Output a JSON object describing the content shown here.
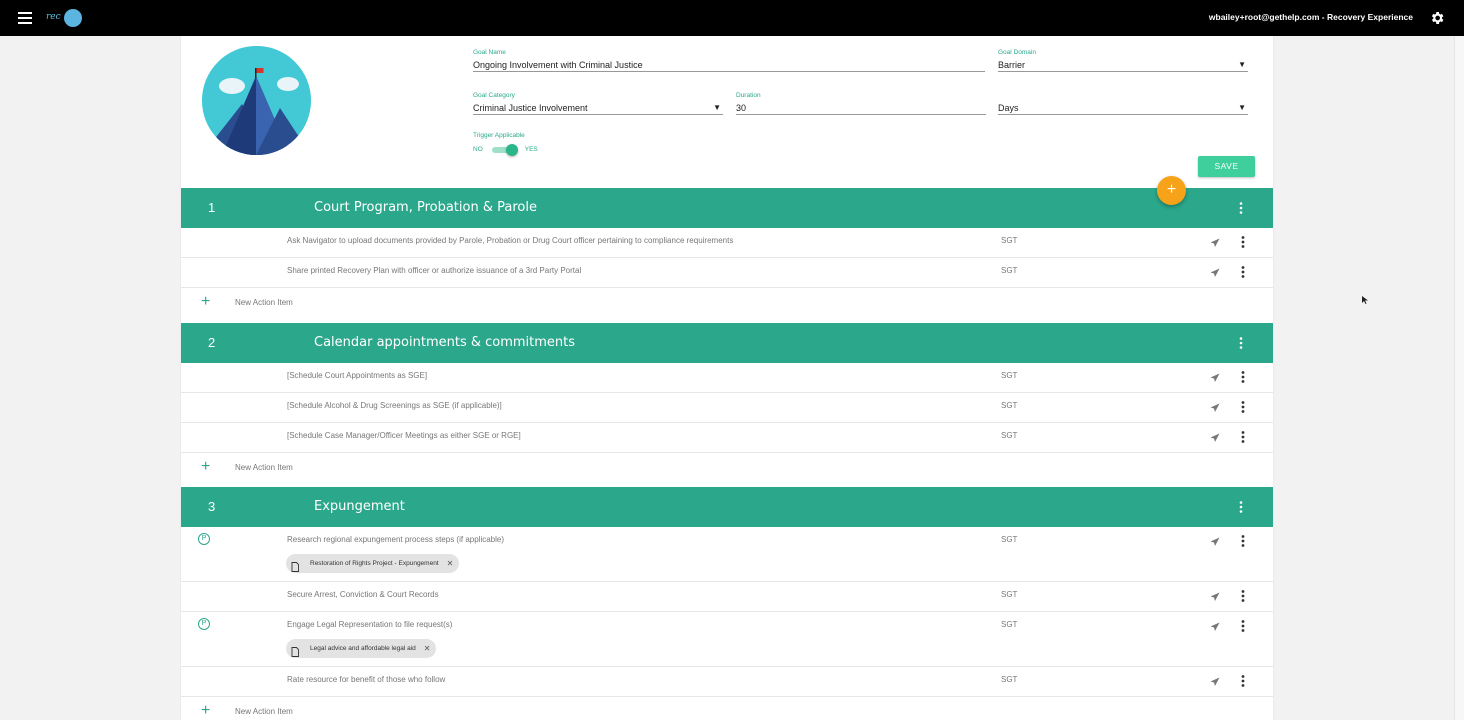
{
  "header": {
    "logo_text": "rec",
    "user_label": "wbailey+root@gethelp.com - Recovery Experience"
  },
  "goal": {
    "name_label": "Goal Name",
    "name_value": "Ongoing Involvement with Criminal Justice",
    "domain_label": "Goal Domain",
    "domain_value": "Barrier",
    "category_label": "Goal Category",
    "category_value": "Criminal Justice Involvement",
    "duration_label": "Duration",
    "duration_value": "30",
    "duration_unit_value": "Days",
    "trigger_label": "Trigger Applicable",
    "trigger_no": "NO",
    "trigger_yes": "YES",
    "trigger_on": true,
    "save_label": "SAVE",
    "fab_label": "+"
  },
  "sections": [
    {
      "num": "1",
      "title": "Court Program, Probation & Parole",
      "rows": [
        {
          "text": "Ask Navigator to upload documents provided by Parole, Probation or Drug Court officer pertaining to compliance requirements",
          "owner": "SGT"
        },
        {
          "text": "Share printed Recovery Plan with officer or authorize issuance of a 3rd Party Portal",
          "owner": "SGT"
        }
      ],
      "new_label": "New Action Item"
    },
    {
      "num": "2",
      "title": "Calendar appointments & commitments",
      "rows": [
        {
          "text": "[Schedule Court Appointments as SGE]",
          "owner": "SGT"
        },
        {
          "text": "[Schedule Alcohol & Drug Screenings as SGE (if applicable)]",
          "owner": "SGT"
        },
        {
          "text": "[Schedule Case Manager/Officer Meetings as either SGE or RGE]",
          "owner": "SGT"
        }
      ],
      "new_label": "New Action Item"
    },
    {
      "num": "3",
      "title": "Expungement",
      "rows": [
        {
          "text": "Research regional expungement process steps (if applicable)",
          "owner": "SGT",
          "pin": "P",
          "chip": "Restoration of Rights Project - Expungement"
        },
        {
          "text": "Secure Arrest, Conviction & Court Records",
          "owner": "SGT"
        },
        {
          "text": "Engage Legal Representation to file request(s)",
          "owner": "SGT",
          "pin": "P",
          "chip": "Legal advice and affordable legal aid"
        },
        {
          "text": "Rate resource for benefit of those who follow",
          "owner": "SGT"
        }
      ],
      "new_label": "New Action Item"
    }
  ],
  "colors": {
    "topbar": "#000000",
    "accent": "#2ba88c",
    "save": "#3fcf9c",
    "fab": "#f7a31a"
  },
  "icons": [
    "hamburger-icon",
    "gear-icon",
    "send-icon",
    "more-vert-icon",
    "plus-icon",
    "document-icon",
    "close-icon",
    "pin-icon"
  ]
}
